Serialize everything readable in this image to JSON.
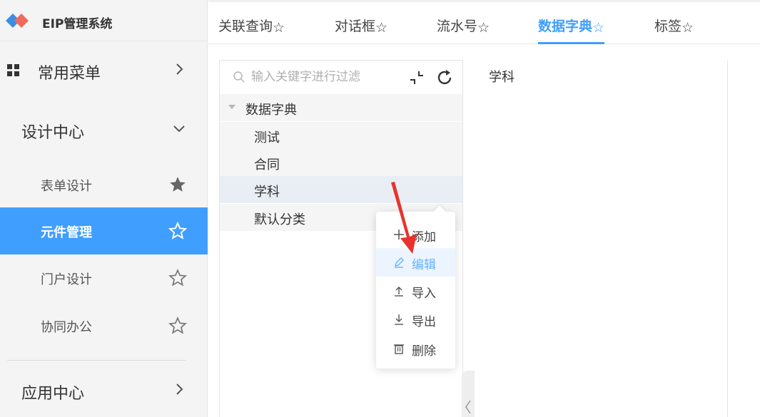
{
  "app": {
    "title": "EIP管理系统"
  },
  "sidebar": {
    "groups": [
      {
        "label": "常用菜单",
        "icon": "grid-icon",
        "state": "collapsed"
      },
      {
        "label": "设计中心",
        "state": "expanded"
      },
      {
        "label": "应用中心",
        "state": "collapsed"
      }
    ],
    "items": [
      {
        "label": "表单设计",
        "starred": true
      },
      {
        "label": "元件管理",
        "starred": false,
        "active": true
      },
      {
        "label": "门户设计",
        "starred": false
      },
      {
        "label": "协同办公",
        "starred": false
      }
    ]
  },
  "tabs": [
    {
      "label": "关联查询"
    },
    {
      "label": "对话框"
    },
    {
      "label": "流水号"
    },
    {
      "label": "数据字典",
      "active": true
    },
    {
      "label": "标签"
    }
  ],
  "tree": {
    "search_placeholder": "输入关键字进行过滤",
    "root": "数据字典",
    "children": [
      "测试",
      "合同",
      "学科",
      "默认分类"
    ],
    "selected": "学科"
  },
  "detail": {
    "title": "学科"
  },
  "context_menu": {
    "items": [
      {
        "label": "添加",
        "icon": "plus-icon"
      },
      {
        "label": "编辑",
        "icon": "edit-icon",
        "hover": true
      },
      {
        "label": "导入",
        "icon": "upload-icon"
      },
      {
        "label": "导出",
        "icon": "download-icon"
      },
      {
        "label": "删除",
        "icon": "trash-icon"
      }
    ]
  },
  "colors": {
    "accent": "#409eff",
    "sidebar_bg": "#f4f4f4",
    "annotation": "#e8322d"
  }
}
